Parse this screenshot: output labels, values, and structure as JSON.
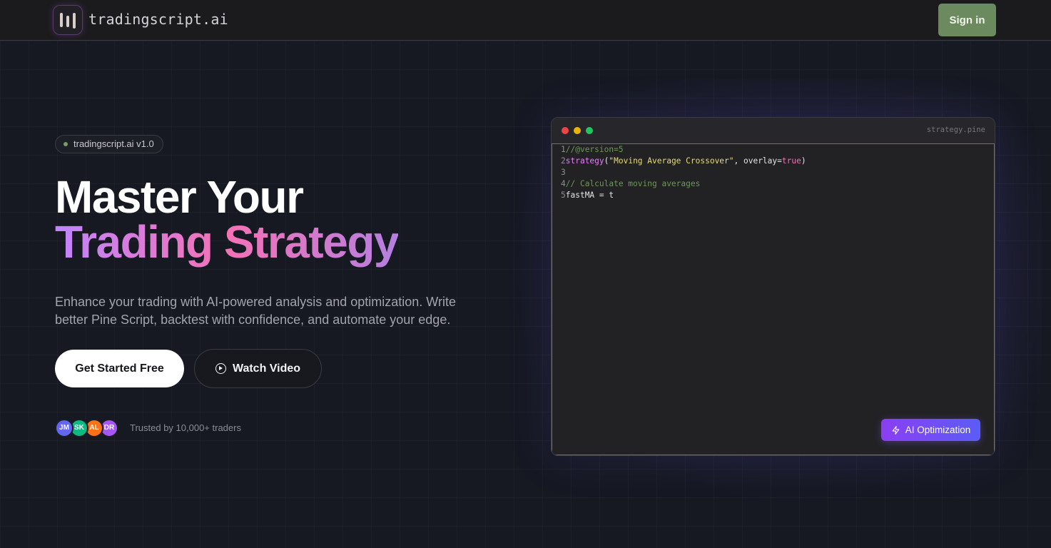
{
  "header": {
    "brand": "tradingscript.ai",
    "signin_label": "Sign in"
  },
  "hero": {
    "badge": "tradingscript.ai v1.0",
    "title_line1": "Master Your",
    "title_line2": "Trading Strategy",
    "subtitle": "Enhance your trading with AI-powered analysis and optimization. Write better Pine Script, backtest with confidence, and automate your edge.",
    "primary_cta": "Get Started Free",
    "secondary_cta": "Watch Video",
    "avatars": [
      {
        "initials": "JM",
        "color": "#6366f1"
      },
      {
        "initials": "SK",
        "color": "#10b981"
      },
      {
        "initials": "AL",
        "color": "#f97316"
      },
      {
        "initials": "DR",
        "color": "#a855f7"
      }
    ],
    "trusted_text": "Trusted by 10,000+ traders"
  },
  "editor": {
    "filename": "strategy.pine",
    "lines": [
      {
        "num": "1",
        "parts": [
          {
            "text": "//@version=5",
            "cls": "c-comment"
          }
        ]
      },
      {
        "num": "2",
        "parts": [
          {
            "text": "strategy",
            "cls": "c-fn"
          },
          {
            "text": "(",
            "cls": "c-plain"
          },
          {
            "text": "\"Moving Average Crossover\"",
            "cls": "c-str"
          },
          {
            "text": ", overlay=",
            "cls": "c-plain"
          },
          {
            "text": "true",
            "cls": "c-kw"
          },
          {
            "text": ")",
            "cls": "c-plain"
          }
        ]
      },
      {
        "num": "3",
        "parts": []
      },
      {
        "num": "4",
        "parts": [
          {
            "text": "// Calculate moving averages",
            "cls": "c-comment"
          }
        ]
      },
      {
        "num": "5",
        "parts": [
          {
            "text": "fastMA = t",
            "cls": "c-plain"
          }
        ]
      }
    ],
    "ai_button": "AI Optimization"
  },
  "colors": {
    "signin_bg": "#6b8a5e",
    "accent_gradient_start": "#8b3ff2",
    "accent_gradient_end": "#5b5cf6"
  }
}
